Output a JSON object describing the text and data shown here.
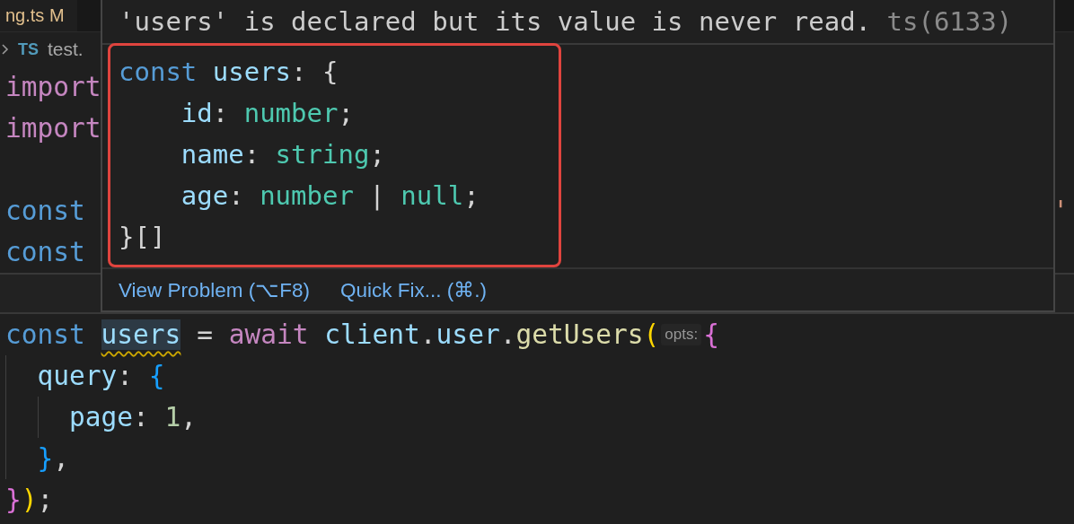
{
  "editor_tab": {
    "label": "ng.ts",
    "status": "M"
  },
  "breadcrumb": {
    "language": "TS",
    "file": "test."
  },
  "code_lines": [
    {
      "current": false,
      "tokens": [
        {
          "text": "import",
          "kind": "keyword"
        }
      ]
    },
    {
      "current": false,
      "tokens": [
        {
          "text": "import",
          "kind": "keyword"
        }
      ]
    },
    {
      "current": false
    },
    {
      "current": false,
      "tokens": [
        {
          "text": "const",
          "kind": "storage"
        }
      ],
      "right_tokens": [
        {
          "text": "'",
          "kind": "string"
        }
      ]
    },
    {
      "current": false,
      "tokens": [
        {
          "text": "const",
          "kind": "storage"
        }
      ]
    },
    {
      "current": true
    },
    {
      "current": false,
      "tokens": [
        {
          "text": "const ",
          "kind": "storage"
        },
        {
          "text": "users",
          "kind": "variable",
          "warning": true
        },
        {
          "text": " = ",
          "kind": "punct"
        },
        {
          "text": "await ",
          "kind": "keyword"
        },
        {
          "text": "client",
          "kind": "variable"
        },
        {
          "text": ".",
          "kind": "punct"
        },
        {
          "text": "user",
          "kind": "variable"
        },
        {
          "text": ".",
          "kind": "punct"
        },
        {
          "text": "getUsers",
          "kind": "function"
        },
        {
          "text": "(",
          "kind": "bracket1"
        },
        {
          "text": "opts:",
          "kind": "hint"
        },
        {
          "text": "{",
          "kind": "bracket2"
        }
      ],
      "children": [
        {
          "current": false,
          "tokens": [
            {
              "text": "query",
              "kind": "variable"
            },
            {
              "text": ": ",
              "kind": "punct"
            },
            {
              "text": "{",
              "kind": "bracket3"
            }
          ],
          "children": [
            {
              "current": false,
              "tokens": [
                {
                  "text": "page",
                  "kind": "variable"
                },
                {
                  "text": ": ",
                  "kind": "punct"
                },
                {
                  "text": "1",
                  "kind": "number"
                },
                {
                  "text": ",",
                  "kind": "punct"
                }
              ]
            }
          ]
        },
        {
          "current": false,
          "tokens": [
            {
              "text": "}",
              "kind": "bracket3"
            },
            {
              "text": ",",
              "kind": "punct"
            }
          ]
        }
      ]
    },
    {
      "current": false,
      "tokens": [
        {
          "text": "}",
          "kind": "bracket2"
        },
        {
          "text": ")",
          "kind": "bracket1"
        },
        {
          "text": ";",
          "kind": "punct"
        }
      ]
    }
  ],
  "hover": {
    "message": "'users' is declared but its value is never read.",
    "code": "ts(6133)",
    "type_lines": [
      [
        {
          "text": "const ",
          "kind": "storage"
        },
        {
          "text": "users",
          "kind": "variable"
        },
        {
          "text": ": {",
          "kind": "punct"
        }
      ],
      [
        {
          "text": "    id",
          "kind": "variable"
        },
        {
          "text": ": ",
          "kind": "punct"
        },
        {
          "text": "number",
          "kind": "type"
        },
        {
          "text": ";",
          "kind": "punct"
        }
      ],
      [
        {
          "text": "    name",
          "kind": "variable"
        },
        {
          "text": ": ",
          "kind": "punct"
        },
        {
          "text": "string",
          "kind": "type"
        },
        {
          "text": ";",
          "kind": "punct"
        }
      ],
      [
        {
          "text": "    age",
          "kind": "variable"
        },
        {
          "text": ": ",
          "kind": "punct"
        },
        {
          "text": "number",
          "kind": "type"
        },
        {
          "text": " | ",
          "kind": "punct"
        },
        {
          "text": "null",
          "kind": "type"
        },
        {
          "text": ";",
          "kind": "punct"
        }
      ],
      [
        {
          "text": "}[]",
          "kind": "punct"
        }
      ]
    ],
    "actions": [
      {
        "label": "View Problem (⌥F8)"
      },
      {
        "label": "Quick Fix... (⌘.)"
      }
    ]
  }
}
